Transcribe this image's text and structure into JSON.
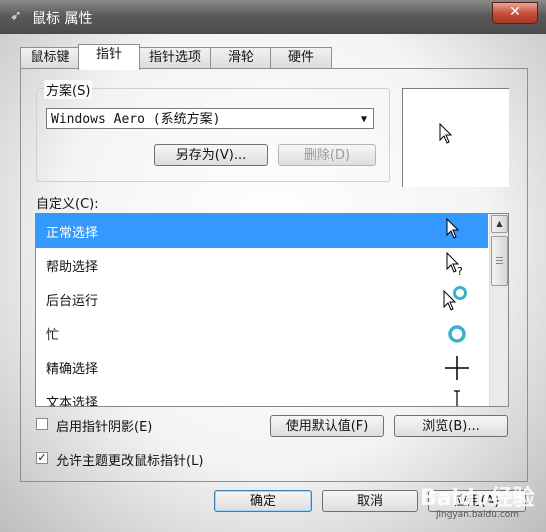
{
  "window": {
    "title": "鼠标 属性",
    "close_glyph": "✕"
  },
  "tabs": [
    {
      "label": "鼠标键"
    },
    {
      "label": "指针"
    },
    {
      "label": "指针选项"
    },
    {
      "label": "滑轮"
    },
    {
      "label": "硬件"
    }
  ],
  "scheme": {
    "label": "方案(S)",
    "selected": "Windows Aero (系统方案)",
    "save_as": "另存为(V)...",
    "delete": "删除(D)"
  },
  "custom": {
    "label": "自定义(C):",
    "items": [
      {
        "label": "正常选择",
        "cursor": "arrow-cursor-icon"
      },
      {
        "label": "帮助选择",
        "cursor": "help-cursor-icon"
      },
      {
        "label": "后台运行",
        "cursor": "working-in-background-icon"
      },
      {
        "label": "忙",
        "cursor": "busy-ring-icon"
      },
      {
        "label": "精确选择",
        "cursor": "crosshair-icon"
      },
      {
        "label": "文本选择",
        "cursor": "text-ibeam-icon"
      }
    ]
  },
  "options": {
    "shadow_label": "启用指针阴影(E)",
    "shadow_checked": false,
    "theme_label": "允许主题更改鼠标指针(L)",
    "theme_checked": true,
    "use_default": "使用默认值(F)",
    "browse": "浏览(B)..."
  },
  "footer": {
    "ok": "确定",
    "cancel": "取消",
    "apply": "应用(A)"
  },
  "watermark": {
    "text": "Baidu经验",
    "url": "jingyan.baidu.com"
  },
  "colors": {
    "selection": "#3399ff",
    "ring": "#3ab3c8"
  }
}
